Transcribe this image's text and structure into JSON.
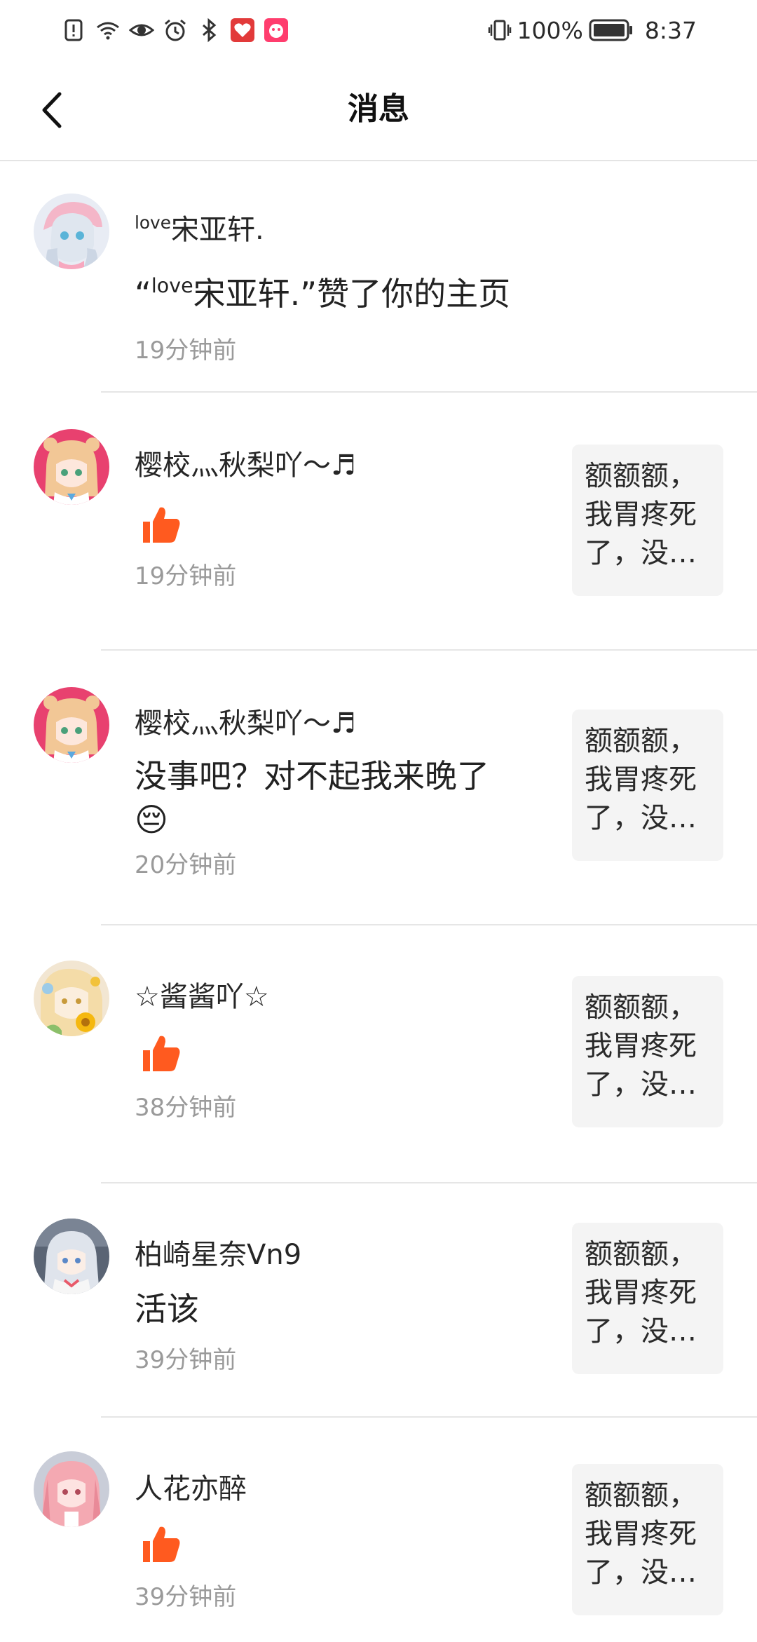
{
  "status_bar": {
    "battery_percent": "100%",
    "time": "8:37",
    "icons": [
      "alert-icon",
      "wifi-icon",
      "eye-icon",
      "alarm-icon",
      "bluetooth-icon",
      "app-icon-red",
      "app-icon-pink",
      "vibrate-icon",
      "battery-icon"
    ]
  },
  "header": {
    "back_icon": "chevron-left-icon",
    "title": "消息"
  },
  "colors": {
    "like_orange": "#ff5a1f",
    "time_gray": "#9a9a9a",
    "divider": "#e6e6e6",
    "preview_bg": "#f4f4f4"
  },
  "messages": [
    {
      "name_prefix": "love",
      "name": "宋亚轩.",
      "body_open": "“",
      "body_prefix": "love",
      "body": "宋亚轩.”赞了你的主页",
      "time": "19分钟前"
    },
    {
      "name": "樱校灬秋梨吖～♬",
      "like_icon": "thumbs-up-icon",
      "time": "19分钟前",
      "preview": "额额额，我胃疼死了，没…"
    },
    {
      "name": "樱校灬秋梨吖～♬",
      "body": "没事吧？对不起我来晚了😔",
      "time": "20分钟前",
      "preview": "额额额，我胃疼死了，没…"
    },
    {
      "name": "☆酱酱吖☆",
      "like_icon": "thumbs-up-icon",
      "time": "38分钟前",
      "preview": "额额额，我胃疼死了，没…"
    },
    {
      "name": "柏崎星奈Vn9",
      "body": "活该",
      "time": "39分钟前",
      "preview": "额额额，我胃疼死了，没…"
    },
    {
      "name": "人花亦醉",
      "like_icon": "thumbs-up-icon",
      "time": "39分钟前",
      "preview": "额额额，我胃疼死了，没…"
    }
  ]
}
